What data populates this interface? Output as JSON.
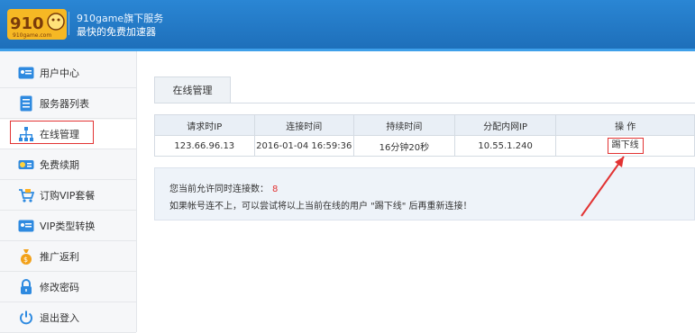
{
  "header": {
    "logo_text": "910game.com",
    "brand_line1": "910game旗下服务",
    "brand_line2": "最快的免费加速器"
  },
  "sidebar": {
    "items": [
      {
        "label": "用户中心",
        "icon": "user-card-icon"
      },
      {
        "label": "服务器列表",
        "icon": "document-icon"
      },
      {
        "label": "在线管理",
        "icon": "network-icon",
        "active": true
      },
      {
        "label": "免费续期",
        "icon": "coins-icon"
      },
      {
        "label": "订购VIP套餐",
        "icon": "shopping-cart-icon"
      },
      {
        "label": "VIP类型转换",
        "icon": "vip-card-icon"
      },
      {
        "label": "推广返利",
        "icon": "money-bag-icon"
      },
      {
        "label": "修改密码",
        "icon": "lock-icon"
      },
      {
        "label": "退出登入",
        "icon": "power-icon"
      }
    ]
  },
  "tabs": [
    {
      "label": "在线管理",
      "active": true
    }
  ],
  "table": {
    "headers": [
      "请求时IP",
      "连接时间",
      "持续时间",
      "分配内网IP",
      "操 作"
    ],
    "rows": [
      {
        "ip": "123.66.96.13",
        "connect_time": "2016-01-04 16:59:36",
        "duration": "16分钟20秒",
        "lan_ip": "10.55.1.240",
        "action": "踢下线"
      }
    ]
  },
  "notice": {
    "line1": "您当前允许同时连接数：",
    "count": "8",
    "line2": "如果帐号连不上，可以尝试将以上当前在线的用户 \"踢下线\" 后再重新连接！"
  },
  "colors": {
    "header_blue": "#1e6fba",
    "highlight_red": "#e23333"
  }
}
